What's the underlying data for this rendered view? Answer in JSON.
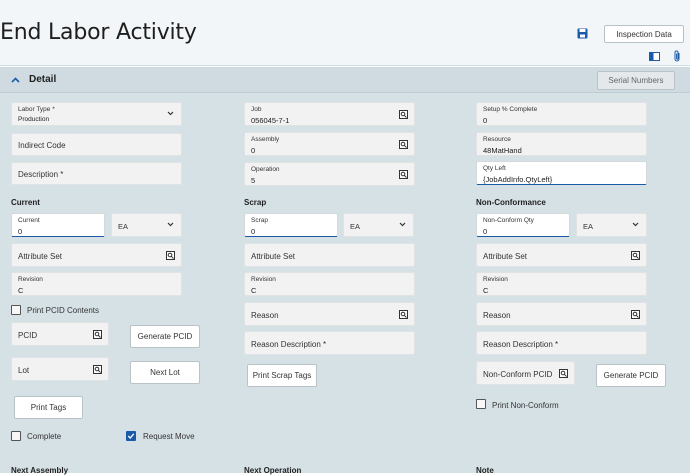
{
  "header": {
    "title": "End Labor Activity",
    "inspection_button": "Inspection Data",
    "save_icon": "save-icon",
    "panel_icon": "panel-icon",
    "attach_icon": "paperclip-icon"
  },
  "detail": {
    "title": "Detail",
    "serial_button": "Serial Numbers"
  },
  "col1": {
    "labor_type": {
      "label": "Labor Type *",
      "value": "Production"
    },
    "indirect_code": "Indirect Code",
    "description": "Description *"
  },
  "col2": {
    "job": {
      "label": "Job",
      "value": "056045-7-1"
    },
    "assembly": {
      "label": "Assembly",
      "value": "0"
    },
    "operation": {
      "label": "Operation",
      "value": "5"
    }
  },
  "col3": {
    "setup": {
      "label": "Setup % Complete",
      "value": "0"
    },
    "resource": {
      "label": "Resource",
      "value": "48MatHand"
    },
    "qty_left": {
      "label": "Qty Left",
      "value": "{JobAddInfo.QtyLeft}"
    }
  },
  "current": {
    "heading": "Current",
    "qty": {
      "label": "Current",
      "value": "0"
    },
    "uom": "EA",
    "attribute_set": "Attribute Set",
    "revision": {
      "label": "Revision",
      "value": "C"
    },
    "print_pcid": "Print PCID Contents",
    "pcid": "PCID",
    "generate_pcid": "Generate PCID",
    "lot": "Lot",
    "next_lot": "Next Lot",
    "print_tags": "Print Tags",
    "complete": "Complete",
    "request_move": "Request Move"
  },
  "scrap": {
    "heading": "Scrap",
    "qty": {
      "label": "Scrap",
      "value": "0"
    },
    "uom": "EA",
    "attribute_set": "Attribute Set",
    "revision": {
      "label": "Revision",
      "value": "C"
    },
    "reason": "Reason",
    "reason_desc": "Reason Description *",
    "print_scrap_tags": "Print Scrap Tags"
  },
  "nonconf": {
    "heading": "Non-Conformance",
    "qty": {
      "label": "Non-Conform Qty",
      "value": "0"
    },
    "uom": "EA",
    "attribute_set": "Attribute Set",
    "revision": {
      "label": "Revision",
      "value": "C"
    },
    "reason": "Reason",
    "reason_desc": "Reason Description *",
    "pcid": "Non-Conform PCID",
    "generate_pcid": "Generate PCID",
    "print_nonconf": "Print Non-Conform"
  },
  "footer": {
    "next_assembly": "Next Assembly",
    "next_operation": "Next Operation",
    "note": "Note"
  },
  "checkboxes": {
    "print_pcid": false,
    "complete": false,
    "request_move": true,
    "print_nonconf": false
  },
  "colors": {
    "accent": "#1b5aa8",
    "content_bg": "#d6e1e6",
    "field_bg": "#f2f2f2"
  }
}
